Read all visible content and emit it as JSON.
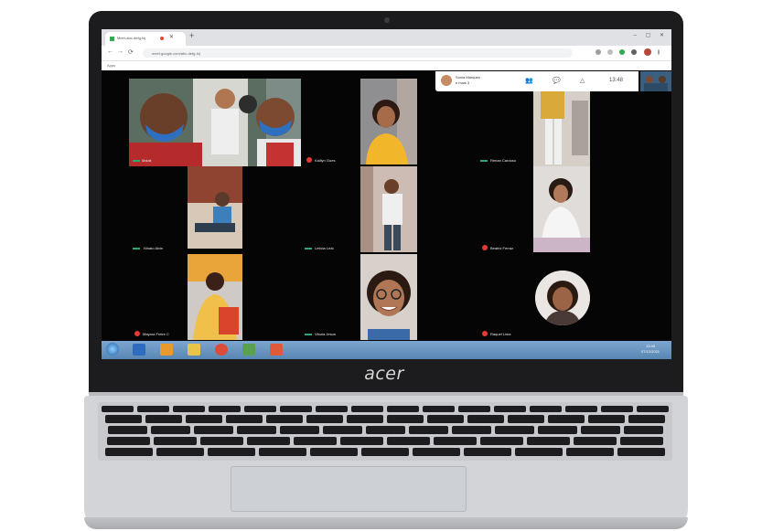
{
  "laptop": {
    "brand": "acer"
  },
  "browser": {
    "tab_title": "Meet-abc-defg-hij",
    "new_tab": "+",
    "window_controls": "– ▢ ✕",
    "url": "meet.google.com/abc-defg-hij",
    "bookmark": "Apps",
    "back": "←",
    "forward": "→",
    "reload": "⟳"
  },
  "meet": {
    "header_name": "Sonia Marques",
    "header_sub": "e mais 3",
    "clock": "13:48",
    "people_icon": "people-icon",
    "chat_icon": "chat-icon",
    "activities_icon": "activities-icon",
    "participants": [
      {
        "name": "Maiali",
        "state": "talking"
      },
      {
        "name": "Kaillyn Gues",
        "state": "muted"
      },
      {
        "name": "Renan Cardoso",
        "state": "talking"
      },
      {
        "name": "Ninato Alvin",
        "state": "talking"
      },
      {
        "name": "Letícia Leal",
        "state": "talking"
      },
      {
        "name": "Beatriz Ferraz",
        "state": "muted"
      },
      {
        "name": "Mayara Freire C",
        "state": "muted"
      },
      {
        "name": "Vitoria Jesus",
        "state": "talking"
      },
      {
        "name": "Raquel Lima",
        "state": "muted"
      }
    ]
  },
  "taskbar": {
    "tray_time": "13:48",
    "tray_date": "07/12/2021"
  },
  "colors": {
    "lid": "#1c1c1e",
    "meet_bg": "#050505",
    "talk_indicator": "#2ba776",
    "mute_indicator": "#e53935",
    "taskbar": "#6b96c2",
    "chassis": "#d2d4d8"
  }
}
